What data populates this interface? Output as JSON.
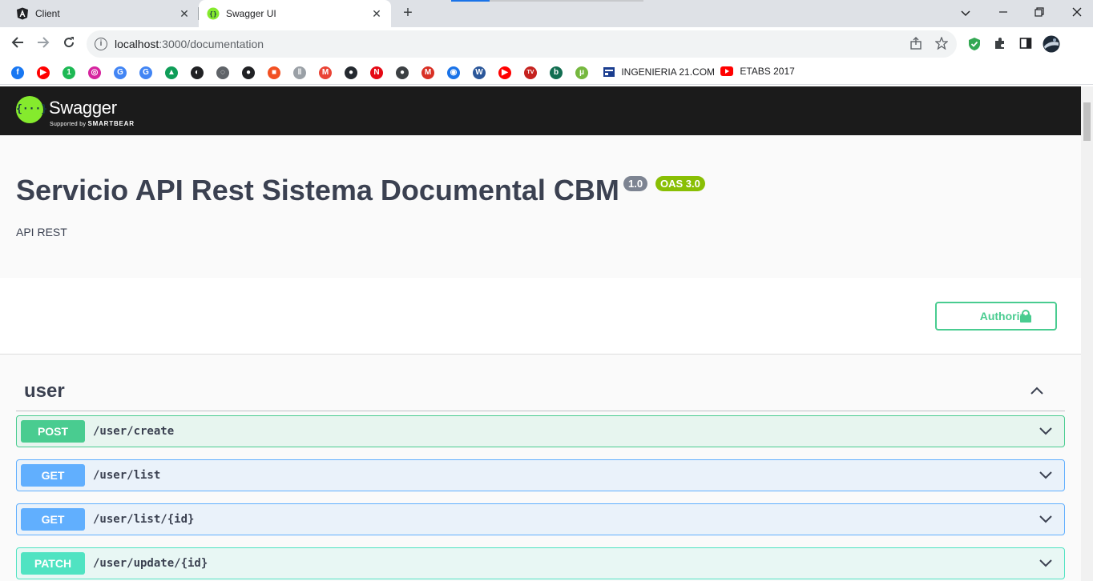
{
  "browser": {
    "tabs": [
      {
        "title": "Client",
        "icon": "angular-icon",
        "active": false
      },
      {
        "title": "Swagger UI",
        "icon": "swagger-icon",
        "active": true
      }
    ],
    "new_tab_label": "+",
    "window_controls": {
      "chevron": "⌄",
      "minimize": "—",
      "restore": "❐",
      "close": "✕"
    },
    "nav": {
      "back": "←",
      "forward": "→",
      "reload": "↻"
    },
    "address": {
      "host": "localhost",
      "path": ":3000/documentation"
    },
    "bookmarks": [
      {
        "icon": "facebook-icon",
        "glyph": "f",
        "color": "#1877f2"
      },
      {
        "icon": "youtube-icon",
        "glyph": "▶",
        "color": "#ff0000"
      },
      {
        "icon": "green-circle-icon",
        "glyph": "1",
        "color": "#1db954"
      },
      {
        "icon": "instagram-icon",
        "glyph": "◎",
        "color": "#d6249f"
      },
      {
        "icon": "google-icon",
        "glyph": "G",
        "color": "#4285f4"
      },
      {
        "icon": "google-icon",
        "glyph": "G",
        "color": "#4285f4"
      },
      {
        "icon": "google-drive-icon",
        "glyph": "▲",
        "color": "#0f9d58"
      },
      {
        "icon": "speedometer-icon",
        "glyph": "◐",
        "color": "#202124"
      },
      {
        "icon": "coin-icon",
        "glyph": "◌",
        "color": "#5f6368"
      },
      {
        "icon": "globe-icon",
        "glyph": "●",
        "color": "#202124"
      },
      {
        "icon": "microsoft-icon",
        "glyph": "■",
        "color": "#f25022"
      },
      {
        "icon": "waveform-icon",
        "glyph": "ǁ",
        "color": "#9aa0a6"
      },
      {
        "icon": "gmail-icon",
        "glyph": "M",
        "color": "#ea4335"
      },
      {
        "icon": "github-icon",
        "glyph": "●",
        "color": "#24292f"
      },
      {
        "icon": "netflix-icon",
        "glyph": "N",
        "color": "#e50914"
      },
      {
        "icon": "dark-circle-icon",
        "glyph": "●",
        "color": "#3c4043"
      },
      {
        "icon": "red-circle-icon",
        "glyph": "M",
        "color": "#d93025"
      },
      {
        "icon": "blue-swirl-icon",
        "glyph": "◉",
        "color": "#1a73e8"
      },
      {
        "icon": "word-icon",
        "glyph": "W",
        "color": "#2b579a"
      },
      {
        "icon": "youtube-icon",
        "glyph": "▶",
        "color": "#ff0000"
      },
      {
        "icon": "tv-icon",
        "glyph": "TV",
        "color": "#c5221f"
      },
      {
        "icon": "bet365-icon",
        "glyph": "b",
        "color": "#126e51"
      },
      {
        "icon": "utorrent-icon",
        "glyph": "μ",
        "color": "#76b83f"
      }
    ],
    "named_bookmarks": [
      {
        "icon": "ingenieria-icon",
        "label": "INGENIERIA 21.COM"
      },
      {
        "icon": "youtube-icon",
        "label": "ETABS 2017"
      }
    ]
  },
  "swagger": {
    "brand": {
      "logo_glyph": "{···}",
      "name": "Swagger",
      "supported_by": "Supported by",
      "company": "SMARTBEAR"
    },
    "info": {
      "title": "Servicio API Rest Sistema Documental CBM",
      "version": "1.0",
      "oas": "OAS 3.0",
      "description": "API REST"
    },
    "authorize_label": "Authorize",
    "tag": {
      "name": "user"
    },
    "operations": [
      {
        "method": "POST",
        "path": "/user/create",
        "kind": "post"
      },
      {
        "method": "GET",
        "path": "/user/list",
        "kind": "get"
      },
      {
        "method": "GET",
        "path": "/user/list/{id}",
        "kind": "get"
      },
      {
        "method": "PATCH",
        "path": "/user/update/{id}",
        "kind": "patch"
      }
    ]
  }
}
